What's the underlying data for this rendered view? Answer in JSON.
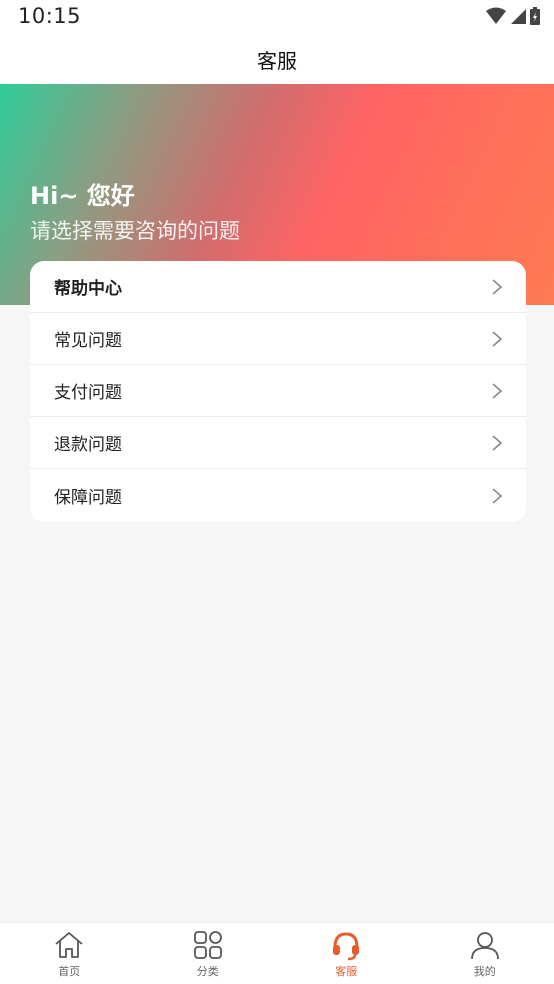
{
  "status_bar": {
    "time": "10:15"
  },
  "nav": {
    "title": "客服"
  },
  "hero": {
    "greeting": "Hi~ 您好",
    "subtitle": "请选择需要咨询的问题"
  },
  "help": {
    "header": "帮助中心",
    "items": [
      {
        "label": "常见问题"
      },
      {
        "label": "支付问题"
      },
      {
        "label": "退款问题"
      },
      {
        "label": "保障问题"
      }
    ]
  },
  "tabs": [
    {
      "label": "首页",
      "icon": "home-icon",
      "active": false
    },
    {
      "label": "分类",
      "icon": "grid-icon",
      "active": false
    },
    {
      "label": "客服",
      "icon": "headset-icon",
      "active": true
    },
    {
      "label": "我的",
      "icon": "user-icon",
      "active": false
    }
  ],
  "colors": {
    "accent": "#e85c2a",
    "hero_start": "#2fcc9a",
    "hero_end": "#ff7a52"
  }
}
